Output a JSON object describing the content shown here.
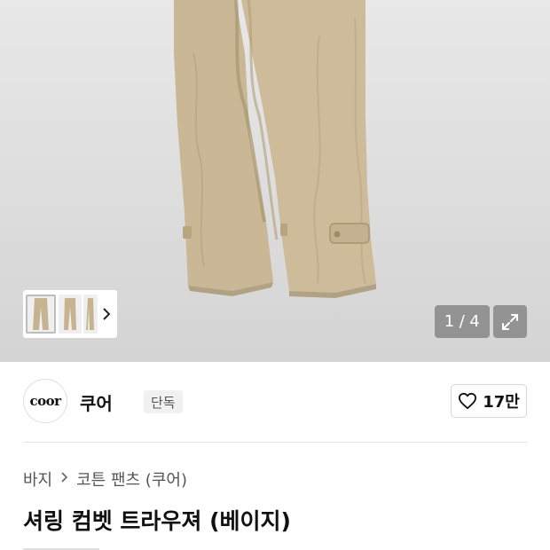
{
  "gallery": {
    "counter_current": "1",
    "counter_separator": "/",
    "counter_total": "4",
    "thumbnails": [
      "thumbnail-1",
      "thumbnail-2",
      "thumbnail-3"
    ],
    "next_icon": "chevron-right-icon",
    "expand_icon": "expand-icon"
  },
  "brand": {
    "logo_text": "coor",
    "name": "쿠어",
    "badge": "단독",
    "like_icon": "heart-icon",
    "like_count": "17만"
  },
  "breadcrumb": {
    "items": [
      "바지",
      "코튼 팬츠 (쿠어)"
    ],
    "separator_icon": "chevron-right-icon"
  },
  "product": {
    "title": "셔링 컴벳 트라우져 (베이지)"
  },
  "colors": {
    "pants": "#c9b796",
    "background": "#dcdcdc",
    "overlay": "#787878"
  }
}
